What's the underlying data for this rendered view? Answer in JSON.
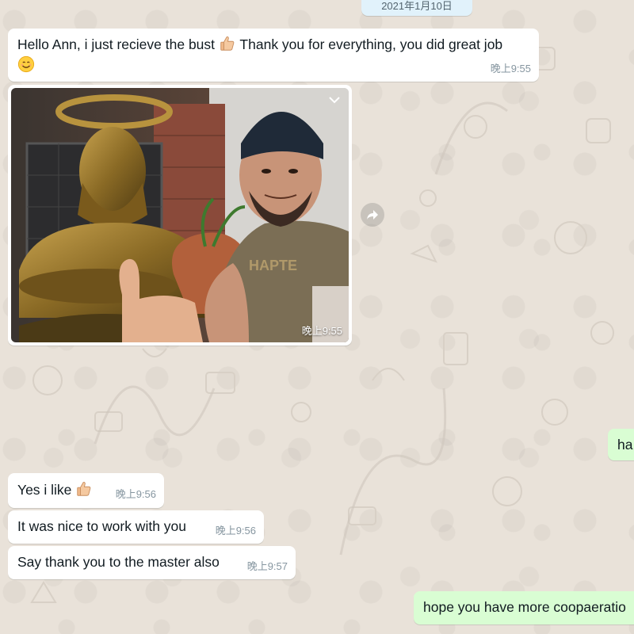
{
  "date_separator": "2021年1月10日",
  "messages": {
    "m1": {
      "text_a": "Hello Ann, i just recieve the bust ",
      "text_b": " Thank you for everything, you did great job",
      "time": "晚上9:55"
    },
    "photo": {
      "time": "晚上9:55",
      "alt": "bust photo"
    },
    "m_out1": {
      "text": "ha"
    },
    "m2": {
      "text": "Yes i like ",
      "time": "晚上9:56"
    },
    "m3": {
      "text": "It was nice to work with you",
      "time": "晚上9:56"
    },
    "m4": {
      "text": "Say thank you to the master also",
      "time": "晚上9:57"
    },
    "m_out2": {
      "text": "hope you have more coopaeratio"
    }
  },
  "icons": {
    "thumb": "thumbs-up-emoji",
    "smile": "smiling-face-emoji",
    "forward": "forward-icon",
    "menu": "chevron-down-icon"
  },
  "colors": {
    "incoming": "#ffffff",
    "outgoing": "#d9fdd3",
    "wallpaper": "#e9e2d9"
  }
}
